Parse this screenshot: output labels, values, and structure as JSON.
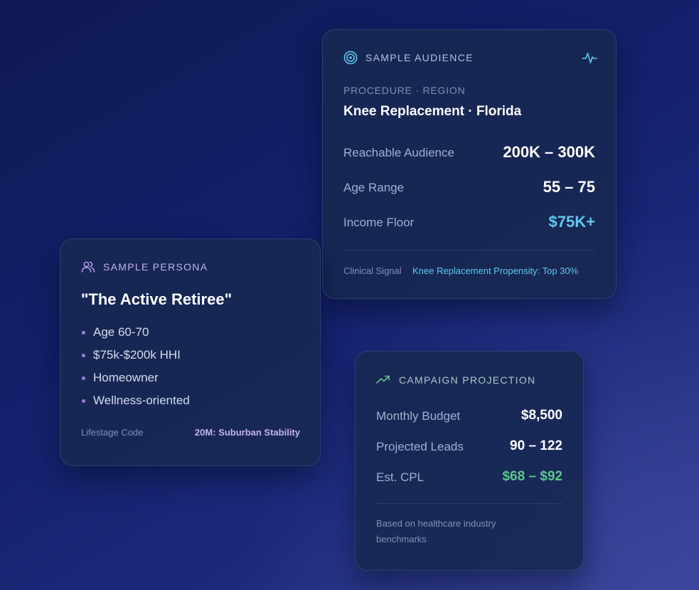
{
  "colors": {
    "background_top": "#0f1a52",
    "card_bg": "#182852",
    "accent_cyan": "#5fc8ee",
    "accent_purple": "#b49ef2",
    "accent_green": "#58c68c"
  },
  "audience": {
    "title": "SAMPLE AUDIENCE",
    "title_icon": "target-icon",
    "header_icon": "activity-pulse-icon",
    "procedure_label": "PROCEDURE · REGION",
    "procedure_value": "Knee Replacement · Florida",
    "rows": [
      {
        "label": "Reachable Audience",
        "value": "200K – 300K"
      },
      {
        "label": "Age Range",
        "value": "55 – 75"
      },
      {
        "label": "Income Floor",
        "value": "$75K+"
      }
    ],
    "signal_label": "Clinical Signal",
    "signal_value": "Knee Replacement Propensity: Top 30%"
  },
  "persona": {
    "title": "SAMPLE PERSONA",
    "title_icon": "users-icon",
    "name": "\"The Active Retiree\"",
    "traits": [
      "Age 60-70",
      "$75k-$200k HHI",
      "Homeowner",
      "Wellness-oriented"
    ],
    "code_label": "Lifestage Code",
    "code_value": "20M: Suburban Stability"
  },
  "campaign": {
    "title": "CAMPAIGN PROJECTION",
    "title_icon": "trending-up-icon",
    "rows": [
      {
        "label": "Monthly Budget",
        "value": "$8,500"
      },
      {
        "label": "Projected Leads",
        "value": "90 – 122"
      },
      {
        "label": "Est. CPL",
        "value": "$68 – $92"
      }
    ],
    "footnote_line1": "Based on healthcare industry",
    "footnote_line2": "benchmarks"
  }
}
